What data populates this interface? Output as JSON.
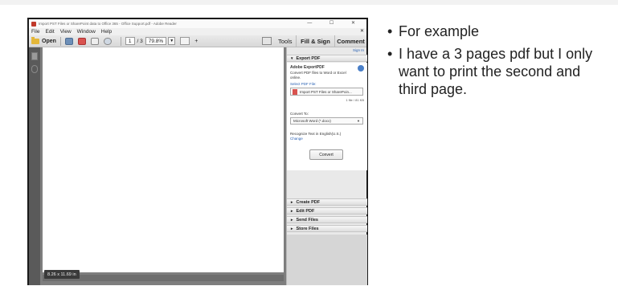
{
  "window": {
    "title": "Import PST Files or SharePoint data to Office 365 - Office Support.pdf - Adobe Reader",
    "controls": "— ☐ ✕"
  },
  "menu": [
    "File",
    "Edit",
    "View",
    "Window",
    "Help"
  ],
  "toolbar": {
    "open_label": "Open",
    "page_current": "1",
    "page_total": "/ 3",
    "zoom": "79.8%",
    "tools_label": "Tools",
    "fill_sign_label": "Fill & Sign",
    "comment_label": "Comment"
  },
  "document": {
    "page_size": "8.26 x 11.69 in"
  },
  "panel": {
    "sign_in": "Sign In",
    "export_pdf": "Export PDF",
    "export_title": "Adobe ExportPDF",
    "export_desc": "Convert PDF files to Word or Excel online.",
    "select_file": "Select PDF File:",
    "file_name": "Import PST Files or SharePoin...",
    "file_count": "1 file / 81 KB",
    "convert_to": "Convert To:",
    "convert_format": "Microsoft Word (*.docx)",
    "recognize_text": "Recognize Text in English(U.S.)",
    "change": "Change",
    "convert_button": "Convert",
    "create_pdf": "Create PDF",
    "edit_pdf": "Edit PDF",
    "send_files": "Send Files",
    "store_files": "Store Files"
  },
  "slide": {
    "bullets": [
      "For example",
      "I have a 3 pages pdf but I only want to print the second and third page."
    ]
  }
}
